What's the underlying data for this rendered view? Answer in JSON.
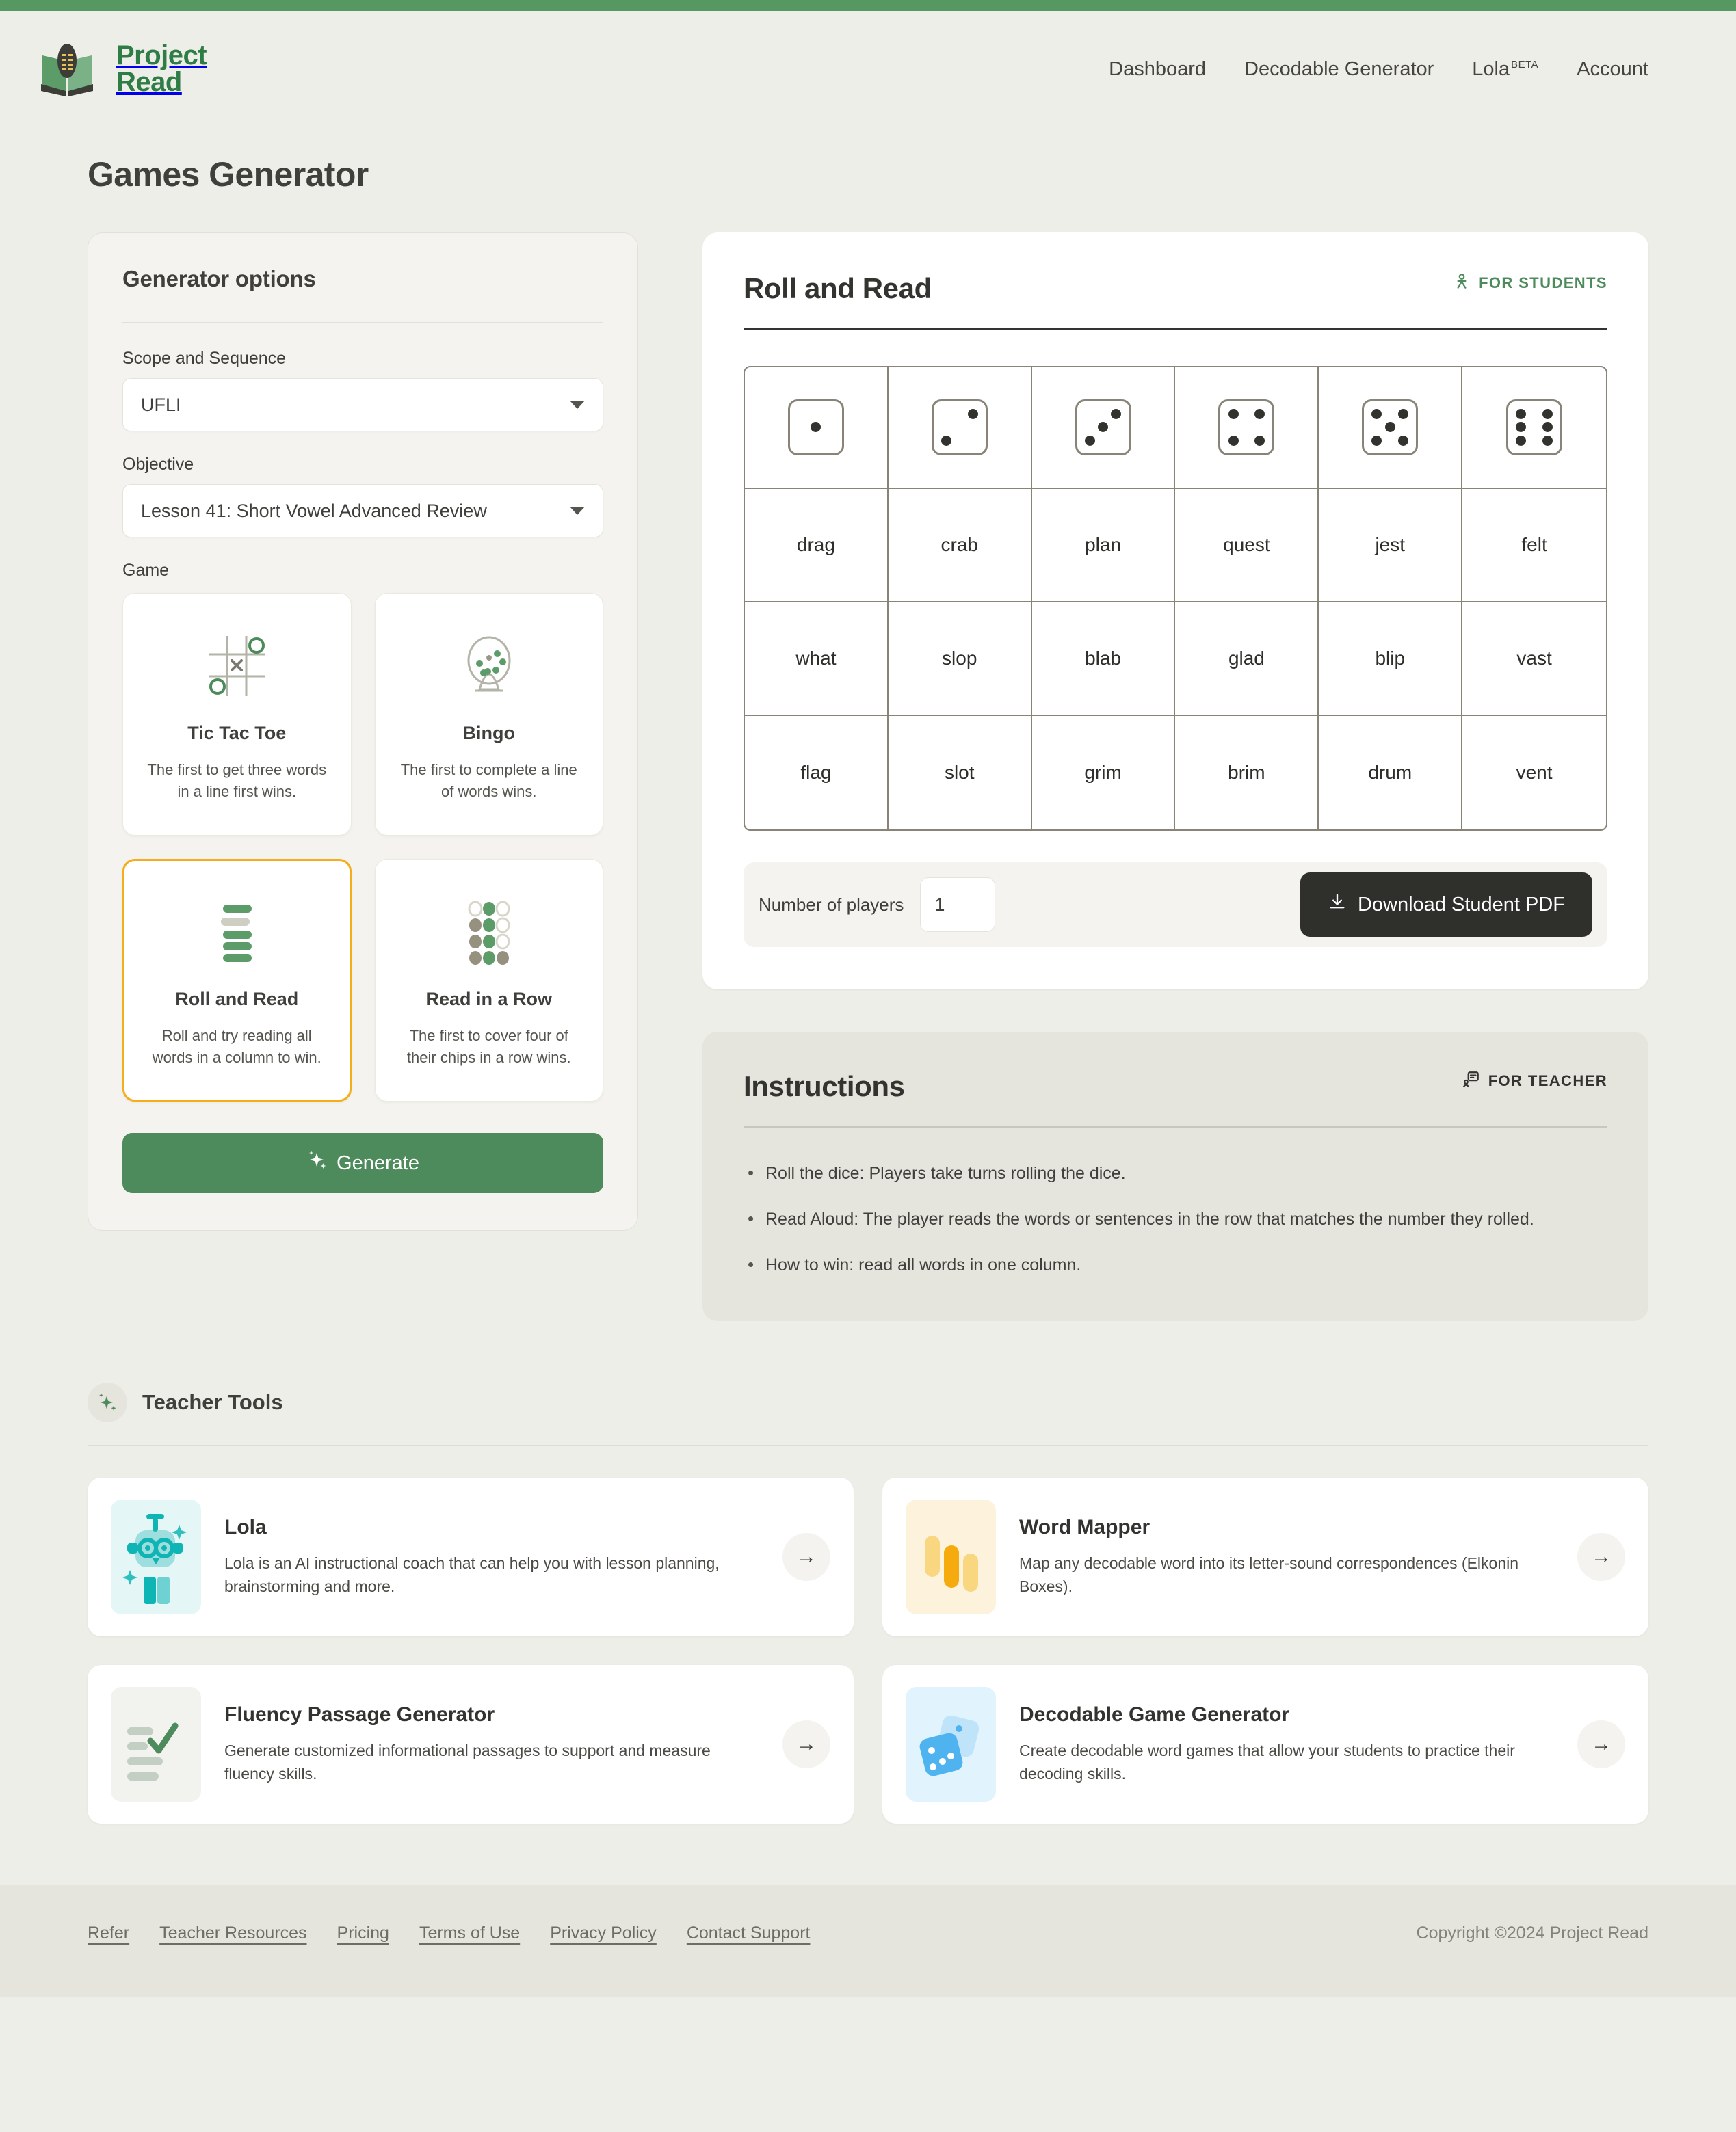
{
  "brand": {
    "line1": "Project",
    "line2": "Read",
    "logo_icon": "open-book-icon"
  },
  "nav": {
    "items": [
      {
        "label": "Dashboard"
      },
      {
        "label": "Decodable Generator"
      },
      {
        "label": "Lola",
        "badge": "BETA"
      },
      {
        "label": "Account"
      }
    ]
  },
  "page": {
    "title": "Games Generator"
  },
  "options": {
    "title": "Generator options",
    "scope_label": "Scope and Sequence",
    "scope_value": "UFLI",
    "objective_label": "Objective",
    "objective_value": "Lesson 41: Short Vowel Advanced Review",
    "game_label": "Game",
    "generate_label": "Generate",
    "games": [
      {
        "name": "Tic Tac Toe",
        "desc": "The first to get three words in a line first wins.",
        "icon": "tic-tac-toe-icon",
        "selected": false
      },
      {
        "name": "Bingo",
        "desc": "The first to complete a line of words wins.",
        "icon": "bingo-cage-icon",
        "selected": false
      },
      {
        "name": "Roll and Read",
        "desc": "Roll and try reading all words in a column to win.",
        "icon": "stacked-bars-icon",
        "selected": true
      },
      {
        "name": "Read in a Row",
        "desc": "The first to cover four of their chips in a row wins.",
        "icon": "chips-grid-icon",
        "selected": false
      }
    ]
  },
  "game_panel": {
    "title": "Roll and Read",
    "audience_label": "FOR STUDENTS",
    "audience_icon": "person-icon",
    "dice": [
      1,
      2,
      3,
      4,
      5,
      6
    ],
    "rows": [
      [
        "drag",
        "crab",
        "plan",
        "quest",
        "jest",
        "felt"
      ],
      [
        "what",
        "slop",
        "blab",
        "glad",
        "blip",
        "vast"
      ],
      [
        "flag",
        "slot",
        "grim",
        "brim",
        "drum",
        "vent"
      ]
    ],
    "players_label": "Number of players",
    "players_value": "1",
    "players_placeholder": "1",
    "download_label": "Download Student PDF",
    "download_icon": "download-icon"
  },
  "instructions": {
    "title": "Instructions",
    "audience_label": "FOR TEACHER",
    "audience_icon": "teacher-card-icon",
    "items": [
      "Roll the dice: Players take turns rolling the dice.",
      "Read Aloud: The player reads the words or sentences in the row that matches the number they rolled.",
      "How to win: read all words in one column."
    ]
  },
  "teacher_tools": {
    "title": "Teacher Tools",
    "icon": "sparkles-icon",
    "cards": [
      {
        "name": "Lola",
        "desc": "Lola is an AI instructional coach that can help you with lesson planning, brainstorming and more.",
        "icon": "robot-icon",
        "arrow_icon": "arrow-right-icon"
      },
      {
        "name": "Word Mapper",
        "desc": "Map any decodable word into its letter-sound correspondences (Elkonin Boxes).",
        "icon": "bars-icon",
        "arrow_icon": "arrow-right-icon"
      },
      {
        "name": "Fluency Passage Generator",
        "desc": "Generate customized informational passages to support and measure fluency skills.",
        "icon": "checklist-icon",
        "arrow_icon": "arrow-right-icon"
      },
      {
        "name": "Decodable Game Generator",
        "desc": "Create decodable word games that allow your students to practice their decoding skills.",
        "icon": "dice-icon",
        "arrow_icon": "arrow-right-icon"
      }
    ]
  },
  "footer": {
    "links": [
      "Refer",
      "Teacher Resources",
      "Pricing",
      "Terms of Use",
      "Privacy Policy",
      "Contact Support"
    ],
    "copyright": "Copyright ©2024 Project Read"
  },
  "colors": {
    "brand_green": "#2f7d46",
    "accent_green": "#4e8b5c",
    "topbar_green": "#579761",
    "selected_gold": "#f5ae1b",
    "page_bg": "#eeeee8",
    "dark": "#2f2f2c"
  }
}
